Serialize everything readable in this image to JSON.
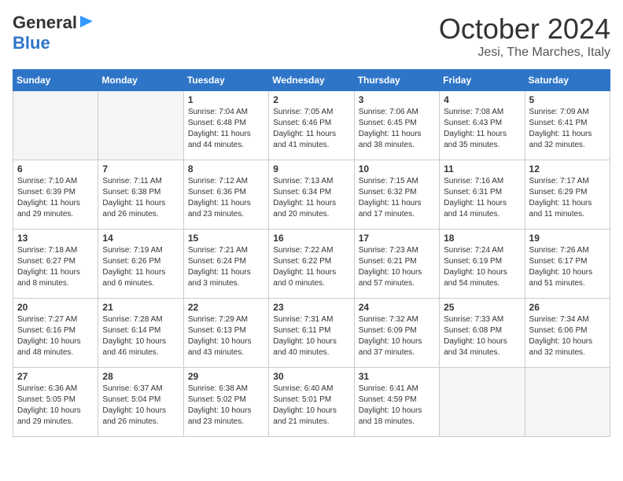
{
  "header": {
    "logo_line1": "General",
    "logo_line2": "Blue",
    "month": "October 2024",
    "location": "Jesi, The Marches, Italy"
  },
  "weekdays": [
    "Sunday",
    "Monday",
    "Tuesday",
    "Wednesday",
    "Thursday",
    "Friday",
    "Saturday"
  ],
  "weeks": [
    [
      {
        "day": "",
        "info": ""
      },
      {
        "day": "",
        "info": ""
      },
      {
        "day": "1",
        "info": "Sunrise: 7:04 AM\nSunset: 6:48 PM\nDaylight: 11 hours and 44 minutes."
      },
      {
        "day": "2",
        "info": "Sunrise: 7:05 AM\nSunset: 6:46 PM\nDaylight: 11 hours and 41 minutes."
      },
      {
        "day": "3",
        "info": "Sunrise: 7:06 AM\nSunset: 6:45 PM\nDaylight: 11 hours and 38 minutes."
      },
      {
        "day": "4",
        "info": "Sunrise: 7:08 AM\nSunset: 6:43 PM\nDaylight: 11 hours and 35 minutes."
      },
      {
        "day": "5",
        "info": "Sunrise: 7:09 AM\nSunset: 6:41 PM\nDaylight: 11 hours and 32 minutes."
      }
    ],
    [
      {
        "day": "6",
        "info": "Sunrise: 7:10 AM\nSunset: 6:39 PM\nDaylight: 11 hours and 29 minutes."
      },
      {
        "day": "7",
        "info": "Sunrise: 7:11 AM\nSunset: 6:38 PM\nDaylight: 11 hours and 26 minutes."
      },
      {
        "day": "8",
        "info": "Sunrise: 7:12 AM\nSunset: 6:36 PM\nDaylight: 11 hours and 23 minutes."
      },
      {
        "day": "9",
        "info": "Sunrise: 7:13 AM\nSunset: 6:34 PM\nDaylight: 11 hours and 20 minutes."
      },
      {
        "day": "10",
        "info": "Sunrise: 7:15 AM\nSunset: 6:32 PM\nDaylight: 11 hours and 17 minutes."
      },
      {
        "day": "11",
        "info": "Sunrise: 7:16 AM\nSunset: 6:31 PM\nDaylight: 11 hours and 14 minutes."
      },
      {
        "day": "12",
        "info": "Sunrise: 7:17 AM\nSunset: 6:29 PM\nDaylight: 11 hours and 11 minutes."
      }
    ],
    [
      {
        "day": "13",
        "info": "Sunrise: 7:18 AM\nSunset: 6:27 PM\nDaylight: 11 hours and 8 minutes."
      },
      {
        "day": "14",
        "info": "Sunrise: 7:19 AM\nSunset: 6:26 PM\nDaylight: 11 hours and 6 minutes."
      },
      {
        "day": "15",
        "info": "Sunrise: 7:21 AM\nSunset: 6:24 PM\nDaylight: 11 hours and 3 minutes."
      },
      {
        "day": "16",
        "info": "Sunrise: 7:22 AM\nSunset: 6:22 PM\nDaylight: 11 hours and 0 minutes."
      },
      {
        "day": "17",
        "info": "Sunrise: 7:23 AM\nSunset: 6:21 PM\nDaylight: 10 hours and 57 minutes."
      },
      {
        "day": "18",
        "info": "Sunrise: 7:24 AM\nSunset: 6:19 PM\nDaylight: 10 hours and 54 minutes."
      },
      {
        "day": "19",
        "info": "Sunrise: 7:26 AM\nSunset: 6:17 PM\nDaylight: 10 hours and 51 minutes."
      }
    ],
    [
      {
        "day": "20",
        "info": "Sunrise: 7:27 AM\nSunset: 6:16 PM\nDaylight: 10 hours and 48 minutes."
      },
      {
        "day": "21",
        "info": "Sunrise: 7:28 AM\nSunset: 6:14 PM\nDaylight: 10 hours and 46 minutes."
      },
      {
        "day": "22",
        "info": "Sunrise: 7:29 AM\nSunset: 6:13 PM\nDaylight: 10 hours and 43 minutes."
      },
      {
        "day": "23",
        "info": "Sunrise: 7:31 AM\nSunset: 6:11 PM\nDaylight: 10 hours and 40 minutes."
      },
      {
        "day": "24",
        "info": "Sunrise: 7:32 AM\nSunset: 6:09 PM\nDaylight: 10 hours and 37 minutes."
      },
      {
        "day": "25",
        "info": "Sunrise: 7:33 AM\nSunset: 6:08 PM\nDaylight: 10 hours and 34 minutes."
      },
      {
        "day": "26",
        "info": "Sunrise: 7:34 AM\nSunset: 6:06 PM\nDaylight: 10 hours and 32 minutes."
      }
    ],
    [
      {
        "day": "27",
        "info": "Sunrise: 6:36 AM\nSunset: 5:05 PM\nDaylight: 10 hours and 29 minutes."
      },
      {
        "day": "28",
        "info": "Sunrise: 6:37 AM\nSunset: 5:04 PM\nDaylight: 10 hours and 26 minutes."
      },
      {
        "day": "29",
        "info": "Sunrise: 6:38 AM\nSunset: 5:02 PM\nDaylight: 10 hours and 23 minutes."
      },
      {
        "day": "30",
        "info": "Sunrise: 6:40 AM\nSunset: 5:01 PM\nDaylight: 10 hours and 21 minutes."
      },
      {
        "day": "31",
        "info": "Sunrise: 6:41 AM\nSunset: 4:59 PM\nDaylight: 10 hours and 18 minutes."
      },
      {
        "day": "",
        "info": ""
      },
      {
        "day": "",
        "info": ""
      }
    ]
  ]
}
